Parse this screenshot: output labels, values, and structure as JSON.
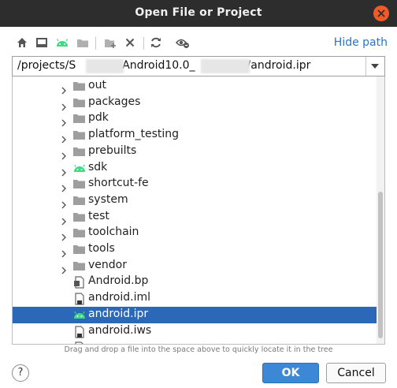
{
  "window": {
    "title": "Open File or Project"
  },
  "toolbar": {
    "icons": [
      "home-icon",
      "desktop-icon",
      "android-icon",
      "folder-icon",
      "new-folder-icon",
      "delete-icon",
      "refresh-icon",
      "show-hidden-icon"
    ],
    "hide_path": "Hide path"
  },
  "path": {
    "value_start": "/projects/S",
    "value_mid": "_Android10.0_",
    "value_end": "/android.ipr"
  },
  "tree": {
    "items": [
      {
        "label": "out",
        "type": "folder",
        "expandable": true,
        "selected": false
      },
      {
        "label": "packages",
        "type": "folder",
        "expandable": true,
        "selected": false
      },
      {
        "label": "pdk",
        "type": "folder",
        "expandable": true,
        "selected": false
      },
      {
        "label": "platform_testing",
        "type": "folder",
        "expandable": true,
        "selected": false
      },
      {
        "label": "prebuilts",
        "type": "folder",
        "expandable": true,
        "selected": false
      },
      {
        "label": "sdk",
        "type": "android",
        "expandable": true,
        "selected": false
      },
      {
        "label": "shortcut-fe",
        "type": "folder",
        "expandable": true,
        "selected": false
      },
      {
        "label": "system",
        "type": "folder",
        "expandable": true,
        "selected": false
      },
      {
        "label": "test",
        "type": "folder",
        "expandable": true,
        "selected": false
      },
      {
        "label": "toolchain",
        "type": "folder",
        "expandable": true,
        "selected": false
      },
      {
        "label": "tools",
        "type": "folder",
        "expandable": true,
        "selected": false
      },
      {
        "label": "vendor",
        "type": "folder",
        "expandable": true,
        "selected": false
      },
      {
        "label": "Android.bp",
        "type": "file",
        "expandable": false,
        "selected": false
      },
      {
        "label": "android.iml",
        "type": "module-file",
        "expandable": false,
        "selected": false
      },
      {
        "label": "android.ipr",
        "type": "android",
        "expandable": false,
        "selected": true
      },
      {
        "label": "android.iws",
        "type": "module-file",
        "expandable": false,
        "selected": false
      },
      {
        "label": "",
        "type": "module-file",
        "expandable": false,
        "selected": false
      }
    ]
  },
  "hint": "Drag and drop a file into the space above to quickly locate it in the tree",
  "buttons": {
    "help": "?",
    "ok": "OK",
    "cancel": "Cancel"
  },
  "colors": {
    "selection": "#2c68b8",
    "link": "#2b73c4",
    "ok_button": "#3d88d6",
    "android_green": "#3ddc84",
    "close_button": "#ef5a28"
  }
}
